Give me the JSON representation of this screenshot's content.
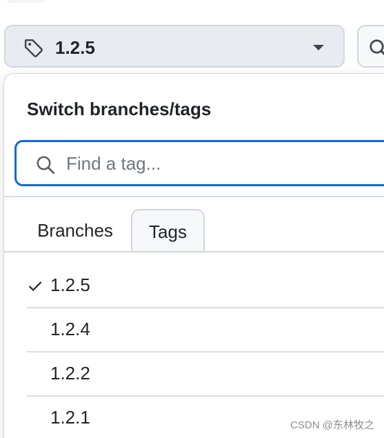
{
  "selector": {
    "current_ref": "1.2.5"
  },
  "panel": {
    "title": "Switch branches/tags",
    "filter": {
      "placeholder": "Find a tag...",
      "value": ""
    },
    "tabs": [
      {
        "label": "Branches",
        "selected": false
      },
      {
        "label": "Tags",
        "selected": true
      }
    ],
    "tags": [
      {
        "name": "1.2.5",
        "checked": true
      },
      {
        "name": "1.2.4",
        "checked": false
      },
      {
        "name": "1.2.2",
        "checked": false
      },
      {
        "name": "1.2.1",
        "checked": false
      }
    ]
  },
  "watermark": "CSDN @东林牧之",
  "icons": {
    "ref_icon": "tag-icon",
    "caret": "caret-down-icon",
    "filter_icon": "search-icon",
    "side_button_icon": "search-icon",
    "selected_marker": "check-icon"
  },
  "colors": {
    "accent": "#0969da",
    "button_bg": "#e8ebef",
    "border": "#d0d7de",
    "text": "#1f2328",
    "muted": "#6e7781"
  }
}
